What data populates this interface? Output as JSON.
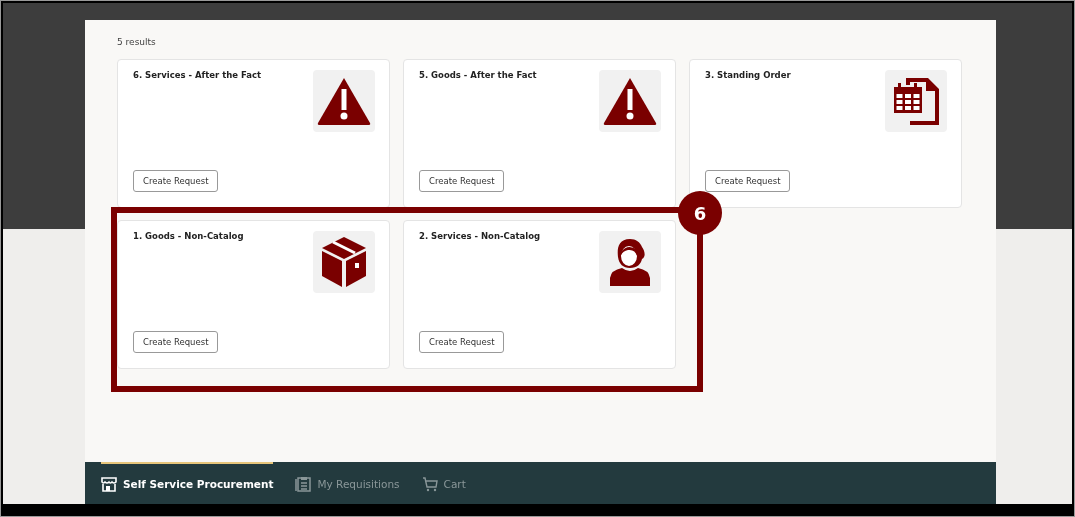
{
  "results_count": "5 results",
  "cards": [
    {
      "title": "6. Services - After the Fact",
      "kind": "warning",
      "button": "Create Request"
    },
    {
      "title": "5. Goods - After the Fact",
      "kind": "warning",
      "button": "Create Request"
    },
    {
      "title": "3. Standing Order",
      "kind": "calendar",
      "button": "Create Request"
    },
    {
      "title": "1. Goods - Non-Catalog",
      "kind": "box",
      "button": "Create Request"
    },
    {
      "title": "2. Services - Non-Catalog",
      "kind": "person",
      "button": "Create Request"
    }
  ],
  "callout": {
    "number": "6"
  },
  "nav_tabs": [
    {
      "label": "Self Service Procurement",
      "kind": "store",
      "selected": true
    },
    {
      "label": "My Requisitions",
      "kind": "clipboard",
      "selected": false
    },
    {
      "label": "Cart",
      "kind": "cart",
      "selected": false
    }
  ]
}
